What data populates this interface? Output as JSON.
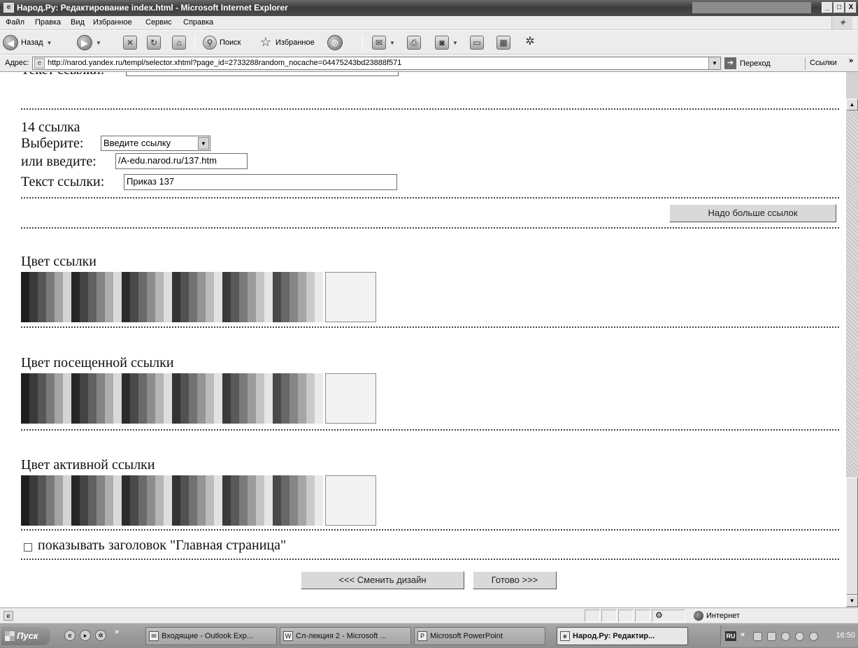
{
  "window": {
    "title": "Народ.Ру: Редактирование index.html - Microsoft Internet Explorer",
    "buttons": [
      "_",
      "□",
      "X"
    ]
  },
  "menu": [
    "Файл",
    "Правка",
    "Вид",
    "Избранное",
    "Сервис",
    "Справка"
  ],
  "toolbar": {
    "back": "Назад",
    "search": "Поиск",
    "favorites": "Избранное"
  },
  "address": {
    "label": "Адрес:",
    "url": "http://narod.yandex.ru/templ/selector.xhtml?page_id=2733288random_nocache=04475243bd23888f571",
    "go": "Переход",
    "links": "Ссылки",
    "chevron": "»"
  },
  "content": {
    "cut_label": "Текст ссылки:",
    "link14": {
      "heading": "14 ссылка",
      "choose_label": "Выберите:",
      "choose_value": "Введите ссылку",
      "or_enter_label": "или введите:",
      "or_enter_value": "/A-edu.narod.ru/137.htm",
      "text_label": "Текст ссылки:",
      "text_value": "Приказ 137"
    },
    "more_links_button": "Надо больше ссылок",
    "link_color_label": "Цвет ссылки",
    "visited_color_label": "Цвет посещенной ссылки",
    "active_color_label": "Цвет активной ссылки",
    "show_header_checkbox": "показывать заголовок \"Главная страница\"",
    "change_design_button": "<<< Сменить дизайн",
    "done_button": "Готово >>>"
  },
  "palette_groups": [
    [
      "#1e1e1e",
      "#3a3a3a",
      "#565656",
      "#7a7a7a",
      "#a5a5a5",
      "#d4d4d4"
    ],
    [
      "#262626",
      "#434343",
      "#616161",
      "#848484",
      "#adadad",
      "#d9d9d9"
    ],
    [
      "#2c2c2c",
      "#4a4a4a",
      "#6a6a6a",
      "#8d8d8d",
      "#b5b5b5",
      "#dedede"
    ],
    [
      "#333333",
      "#515151",
      "#727272",
      "#959595",
      "#bcbcbc",
      "#e2e2e2"
    ],
    [
      "#3b3b3b",
      "#595959",
      "#7a7a7a",
      "#9c9c9c",
      "#c3c3c3",
      "#e6e6e6"
    ],
    [
      "#4a4a4a",
      "#676767",
      "#868686",
      "#a6a6a6",
      "#cacaca",
      "#eaeaea"
    ]
  ],
  "status": {
    "zone": "Интернет"
  },
  "taskbar": {
    "start": "Пуск",
    "quicklaunch_chevron": "»",
    "tasks": [
      "Входящие - Outlook Exp...",
      "Сл-лекция 2 - Microsoft ...",
      "Microsoft PowerPoint",
      "Народ.Ру: Редактир..."
    ],
    "lang": "RU",
    "tray_chevron": "«",
    "clock": "16:50"
  }
}
